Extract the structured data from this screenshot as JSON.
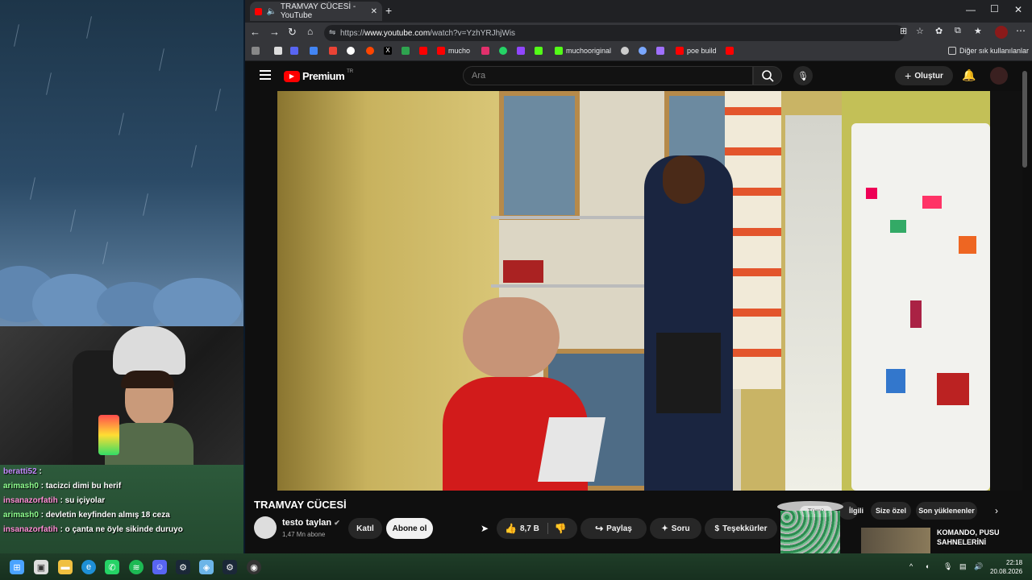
{
  "browser": {
    "tab_title": "TRAMVAY CÜCESİ - YouTube",
    "url_prefix": "https://",
    "url_host": "www.youtube.com",
    "url_path": "/watch?v=YzhYRJhjWis",
    "bookmarks": [
      {
        "label": "mucho",
        "color": "#ff0000"
      },
      {
        "label": "muchooriginal",
        "color": "#53fc18"
      },
      {
        "label": "poe build",
        "color": "#ff0000"
      }
    ],
    "other_bookmarks": "Diğer sık kullanılanlar"
  },
  "youtube": {
    "logo": "Premium",
    "logo_region": "TR",
    "search_placeholder": "Ara",
    "create_label": "Oluştur",
    "video_title": "TRAMVAY CÜCESİ",
    "channel_name": "testo taylan",
    "subscribers": "1,47 Mn abone",
    "join_label": "Katıl",
    "subscribe_label": "Abone ol",
    "likes": "8,7 B",
    "share_label": "Paylaş",
    "ask_label": "Soru",
    "thanks_label": "Teşekkürler",
    "filter_chips": [
      "Tümü",
      "İlgili",
      "Size özel",
      "Son yüklenenler"
    ],
    "recommended_title_line1": "KOMANDO, PUSU",
    "recommended_title_line2": "SAHNELERİNİ"
  },
  "chat": [
    {
      "user": "beratti52",
      "msg": "",
      "color": "purple"
    },
    {
      "user": "arimash0",
      "msg": ": tacizci dimi bu herif",
      "color": "green"
    },
    {
      "user": "insanazorfatih",
      "msg": ": su içiyolar",
      "color": "pink"
    },
    {
      "user": "arimash0",
      "msg": ": devletin keyfinden almış 18 ceza",
      "color": "green"
    },
    {
      "user": "insanazorfatih",
      "msg": ": o çanta ne öyle sikinde duruyo",
      "color": "pink"
    }
  ],
  "taskbar": {
    "time": "22:18",
    "date": "20.08.2026"
  },
  "colors": {
    "yt_red": "#ff0000",
    "subscribe_bg": "#f1f1f1",
    "browser_dark": "#202124"
  }
}
